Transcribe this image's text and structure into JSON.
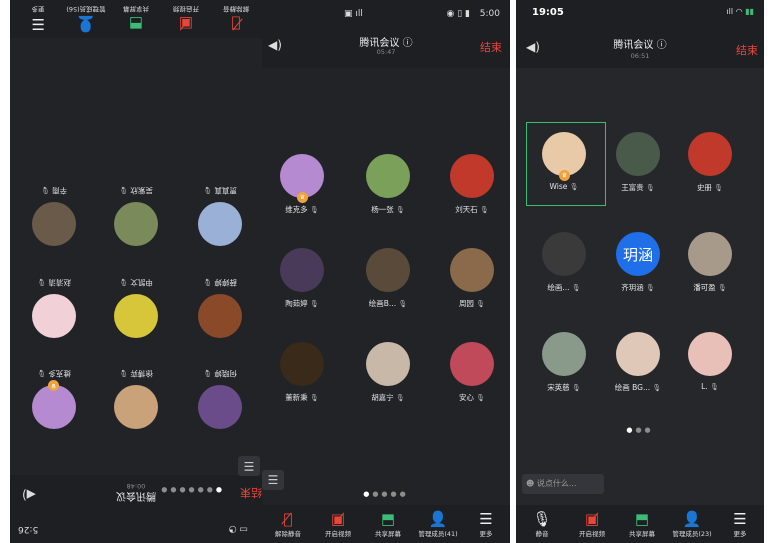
{
  "panel1": {
    "status": {
      "time": "5:26"
    },
    "header": {
      "title": "腾讯会议",
      "timer": "00:48",
      "end": "结束"
    },
    "participants": [
      {
        "name": "何晓婷",
        "color": "#6b4c8a"
      },
      {
        "name": "徐博弈",
        "color": "#c9a27a"
      },
      {
        "name": "维克多",
        "color": "#b58ad1"
      },
      {
        "name": "薛婷婷",
        "color": "#8a4a2a"
      },
      {
        "name": "申凯文",
        "color": "#d7c63a"
      },
      {
        "name": "赵清清",
        "color": "#f1d0d8"
      },
      {
        "name": "贾真真",
        "color": "#9ab0d6"
      },
      {
        "name": "吴紫欣",
        "color": "#7a8a5a"
      },
      {
        "name": "辛雨",
        "color": "#6a5a4a"
      }
    ],
    "toolbar": [
      {
        "label": "解除静音",
        "icon": "mic-off"
      },
      {
        "label": "开启视频",
        "icon": "camera-off"
      },
      {
        "label": "共享屏幕",
        "icon": "share"
      },
      {
        "label": "管理成员(56)",
        "icon": "members"
      },
      {
        "label": "更多",
        "icon": "more"
      }
    ]
  },
  "panel2": {
    "status": {
      "time": "5:00"
    },
    "header": {
      "title": "腾讯会议 ⓘ",
      "timer": "05:47",
      "end": "结束"
    },
    "participants": [
      {
        "name": "维克多",
        "color": "#b58ad1"
      },
      {
        "name": "杨一张",
        "color": "#7aa05a"
      },
      {
        "name": "刘天石",
        "color": "#c0392b"
      },
      {
        "name": "陶茹婷",
        "color": "#4a3a5a"
      },
      {
        "name": "绘画B...",
        "color": "#5a4a3a"
      },
      {
        "name": "周园",
        "color": "#8a6a4a"
      },
      {
        "name": "董新秉",
        "color": "#3a2a1a"
      },
      {
        "name": "胡嘉宁",
        "color": "#c8b8a8"
      },
      {
        "name": "安心",
        "color": "#c04a5a"
      }
    ],
    "toolbar": [
      {
        "label": "解除静音",
        "icon": "mic-off"
      },
      {
        "label": "开启视频",
        "icon": "camera-off"
      },
      {
        "label": "共享屏幕",
        "icon": "share"
      },
      {
        "label": "管理成员(41)",
        "icon": "members"
      },
      {
        "label": "更多",
        "icon": "more"
      }
    ]
  },
  "panel3": {
    "status": {
      "time": "19:05"
    },
    "header": {
      "title": "腾讯会议 ⓘ",
      "timer": "06:51",
      "end": "结束"
    },
    "participants": [
      {
        "name": "Wise",
        "color": "#e8c9a8"
      },
      {
        "name": "王富贵",
        "color": "#4a5a4a"
      },
      {
        "name": "史册",
        "color": "#c0392b"
      },
      {
        "name": "绘画...",
        "color": "#3a3a3a"
      },
      {
        "name": "齐玥涵",
        "color": "#1e6fe8",
        "text": "玥涵"
      },
      {
        "name": "潘可盈",
        "color": "#a89a8a"
      },
      {
        "name": "宋英慈",
        "color": "#8a9a8a"
      },
      {
        "name": "绘画 BG...",
        "color": "#e0c8b8"
      },
      {
        "name": "L.",
        "color": "#e8c0b8"
      }
    ],
    "chat_placeholder": "说点什么...",
    "toolbar": [
      {
        "label": "静音",
        "icon": "mic"
      },
      {
        "label": "开启视频",
        "icon": "camera-off"
      },
      {
        "label": "共享屏幕",
        "icon": "share"
      },
      {
        "label": "管理成员(23)",
        "icon": "members"
      },
      {
        "label": "更多",
        "icon": "more"
      }
    ]
  }
}
